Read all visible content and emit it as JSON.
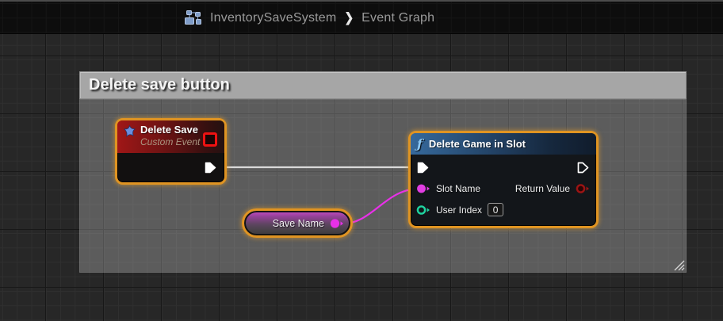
{
  "header": {
    "icon": "blueprint-class-icon",
    "breadcrumb": {
      "root": "InventorySaveSystem",
      "separator": "❯",
      "current": "Event Graph"
    }
  },
  "comment": {
    "title": "Delete save button"
  },
  "nodes": {
    "delete_save": {
      "title": "Delete Save",
      "subtitle": "Custom Event"
    },
    "delete_game_in_slot": {
      "fn_glyph": "ƒ",
      "title": "Delete Game in Slot",
      "pins": {
        "slot_name": "Slot Name",
        "return_value": "Return Value",
        "user_index": "User Index",
        "user_index_value": "0"
      }
    },
    "save_name": {
      "title": "Save Name"
    }
  },
  "colors": {
    "selection_accent": "#E09422",
    "event_header_red": "#A01717",
    "function_header_blue": "#36699C",
    "comment_gray": "#A6A6A6",
    "exec_wire": "#D9D9D9",
    "string_pin": "#E23EE2",
    "bool_pin": "#9C1414",
    "int_pin": "#1FD4A0"
  }
}
